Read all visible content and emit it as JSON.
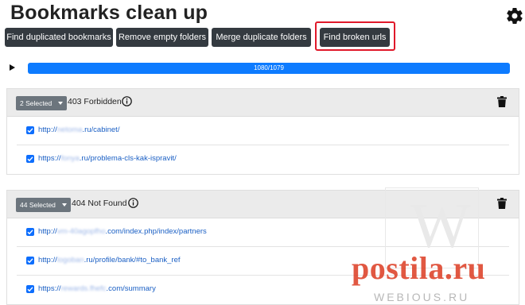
{
  "app": {
    "title": "Bookmarks clean up",
    "settings_icon": "gear-icon"
  },
  "toolbar": {
    "buttons": [
      {
        "label": "Find duplicated bookmarks"
      },
      {
        "label": "Remove empty folders"
      },
      {
        "label": "Merge duplicate folders"
      },
      {
        "label": "Find broken urls"
      }
    ],
    "highlight_color": "#e0192a"
  },
  "progress": {
    "text": "1080/1079",
    "fraction": 1.0,
    "color": "#0d7bff"
  },
  "groups": [
    {
      "selected_label": "2 Selected",
      "status": "403 Forbidden",
      "items": [
        {
          "checked": true,
          "prefix": "http://",
          "hidden": "netoma",
          "suffix": ".ru/cabinet/"
        },
        {
          "checked": true,
          "prefix": "https://",
          "hidden": "fonya",
          "suffix": ".ru/problema-cls-kak-ispravit/"
        }
      ]
    },
    {
      "selected_label": "44 Selected",
      "status": "404 Not Found",
      "items": [
        {
          "checked": true,
          "prefix": "http://",
          "hidden": "vm-40agopfho",
          "suffix": ".com/index.php/index/partners"
        },
        {
          "checked": true,
          "prefix": "http://",
          "hidden": "logoban",
          "suffix": ".ru/profile/bank/#to_bank_ref"
        },
        {
          "checked": true,
          "prefix": "https://",
          "hidden": "rewards.fhefc",
          "suffix": ".com/summary"
        }
      ]
    }
  ],
  "watermark": {
    "letter": "W",
    "text": "postila.ru",
    "sub": "WEBIOUS.RU"
  }
}
